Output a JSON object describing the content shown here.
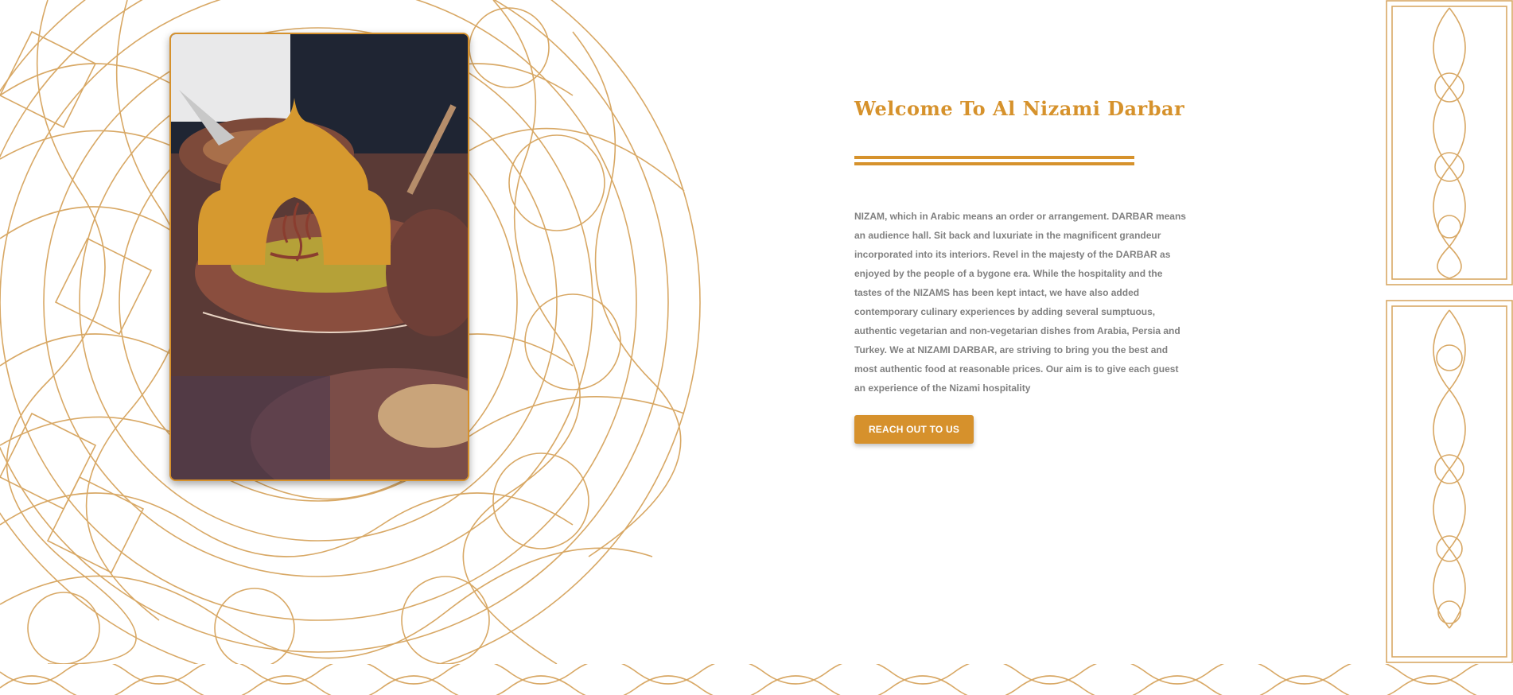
{
  "colors": {
    "accent": "#d6922c",
    "ornament": "#d8a865",
    "body_text": "#808080",
    "button_text": "#ffffff",
    "background": "#ffffff"
  },
  "welcome": {
    "title": "Welcome To Al Nizami Darbar",
    "body": "NIZAM, which in Arabic means an order or arrangement. DARBAR means an audience hall. Sit back and luxuriate in the magnificent grandeur incorporated into its interiors. Revel in the majesty of the DARBAR as enjoyed by the people of a bygone era. While the hospitality and the tastes of the NIZAMS has been kept intact, we have also added contemporary culinary experiences by adding several sumptuous, authentic vegetarian and non-vegetarian dishes from Arabia, Persia and Turkey. We at NIZAMI DARBAR, are striving to bring you the best and most authentic food at reasonable prices. Our aim is to give each guest an experience of the Nizami hospitality",
    "button_label": "REACH OUT TO US"
  },
  "decor": {
    "left_ornament": "arabesque-ornament",
    "right_ornament": "arabesque-panel",
    "bottom_ornament": "arabesque-border",
    "photo_subject": "biryani-clay-pots",
    "logo_icon": "domed-arch-steam-icon"
  }
}
